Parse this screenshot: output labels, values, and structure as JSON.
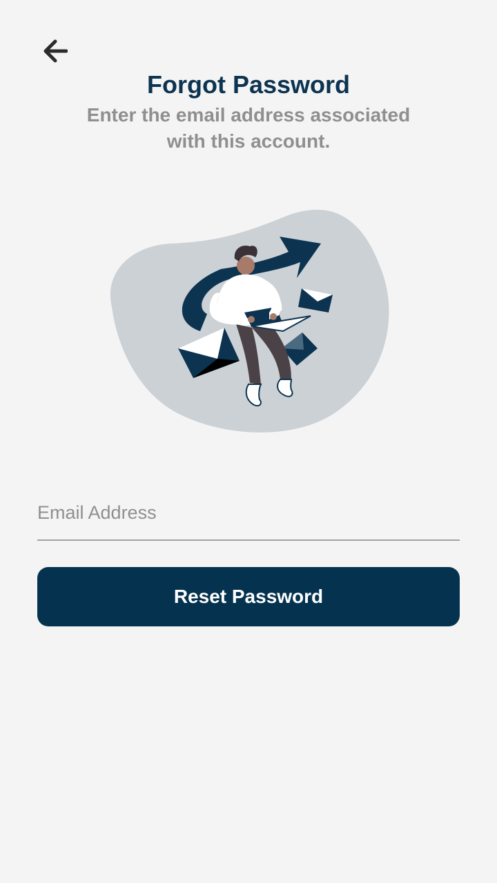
{
  "header": {
    "back_icon": "arrow-left-icon",
    "title": "Forgot Password",
    "subtitle": "Enter the email address associated with this account."
  },
  "illustration": {
    "icon": "person-with-laptop-sending-mail-illustration"
  },
  "form": {
    "email": {
      "value": "",
      "placeholder": "Email Address"
    },
    "submit_label": "Reset Password"
  },
  "colors": {
    "background": "#f4f4f4",
    "primary": "#05334f",
    "title": "#0c3350",
    "muted_text": "#8f8f8f",
    "blob": "#ccd1d6"
  }
}
